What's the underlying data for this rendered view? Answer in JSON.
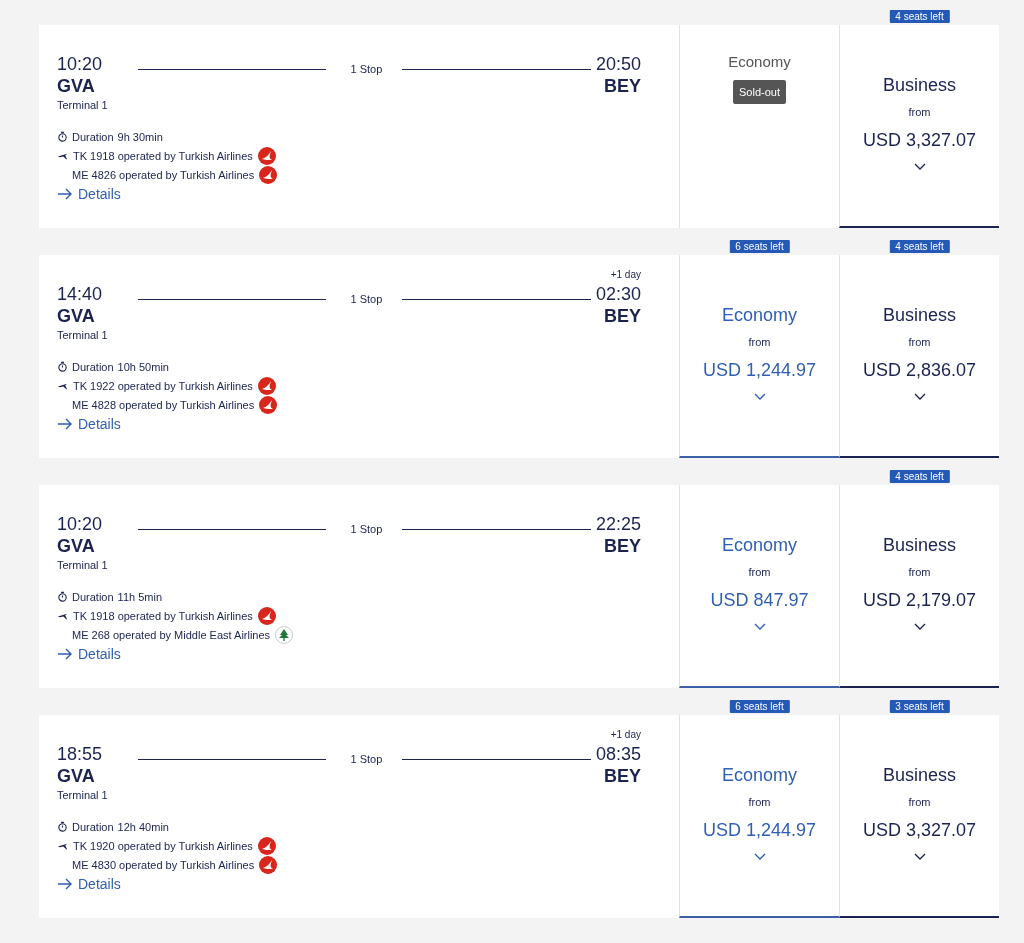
{
  "flights": [
    {
      "depart": {
        "time": "10:20",
        "code": "GVA",
        "terminal": "Terminal 1"
      },
      "stops": "1 Stop",
      "arrive": {
        "time": "20:50",
        "code": "BEY"
      },
      "duration_label": "Duration",
      "duration": "9h 30min",
      "segments": [
        {
          "text": "TK 1918 operated by Turkish Airlines",
          "kind": "turkish"
        },
        {
          "text": "ME 4826 operated by Turkish Airlines",
          "kind": "turkish"
        }
      ],
      "details": "Details",
      "fares": [
        {
          "cabin": "Economy",
          "kind": "soldout",
          "status": "Sold-out"
        },
        {
          "cabin": "Business",
          "kind": "business",
          "badge": "4 seats left",
          "from": "from",
          "price": "USD 3,327.07"
        }
      ]
    },
    {
      "depart": {
        "time": "14:40",
        "code": "GVA",
        "terminal": "Terminal 1"
      },
      "stops": "1 Stop",
      "arrive": {
        "day": "+1 day",
        "time": "02:30",
        "code": "BEY"
      },
      "duration_label": "Duration",
      "duration": "10h 50min",
      "segments": [
        {
          "text": "TK 1922 operated by Turkish Airlines",
          "kind": "turkish"
        },
        {
          "text": "ME 4828 operated by Turkish Airlines",
          "kind": "turkish"
        }
      ],
      "details": "Details",
      "fares": [
        {
          "cabin": "Economy",
          "kind": "economy",
          "badge": "6 seats left",
          "from": "from",
          "price": "USD 1,244.97"
        },
        {
          "cabin": "Business",
          "kind": "business",
          "badge": "4 seats left",
          "from": "from",
          "price": "USD 2,836.07"
        }
      ]
    },
    {
      "depart": {
        "time": "10:20",
        "code": "GVA",
        "terminal": "Terminal 1"
      },
      "stops": "1 Stop",
      "arrive": {
        "time": "22:25",
        "code": "BEY"
      },
      "duration_label": "Duration",
      "duration": "11h 5min",
      "segments": [
        {
          "text": "TK 1918 operated by Turkish Airlines",
          "kind": "turkish"
        },
        {
          "text": "ME 268 operated by Middle East Airlines",
          "kind": "cedar"
        }
      ],
      "details": "Details",
      "fares": [
        {
          "cabin": "Economy",
          "kind": "economy",
          "from": "from",
          "price": "USD 847.97"
        },
        {
          "cabin": "Business",
          "kind": "business",
          "badge": "4 seats left",
          "from": "from",
          "price": "USD 2,179.07"
        }
      ]
    },
    {
      "depart": {
        "time": "18:55",
        "code": "GVA",
        "terminal": "Terminal 1"
      },
      "stops": "1 Stop",
      "arrive": {
        "day": "+1 day",
        "time": "08:35",
        "code": "BEY"
      },
      "duration_label": "Duration",
      "duration": "12h 40min",
      "segments": [
        {
          "text": "TK 1920 operated by Turkish Airlines",
          "kind": "turkish"
        },
        {
          "text": "ME 4830 operated by Turkish Airlines",
          "kind": "turkish"
        }
      ],
      "details": "Details",
      "fares": [
        {
          "cabin": "Economy",
          "kind": "economy",
          "badge": "6 seats left",
          "from": "from",
          "price": "USD 1,244.97"
        },
        {
          "cabin": "Business",
          "kind": "business",
          "badge": "3 seats left",
          "from": "from",
          "price": "USD 3,327.07"
        }
      ]
    }
  ]
}
